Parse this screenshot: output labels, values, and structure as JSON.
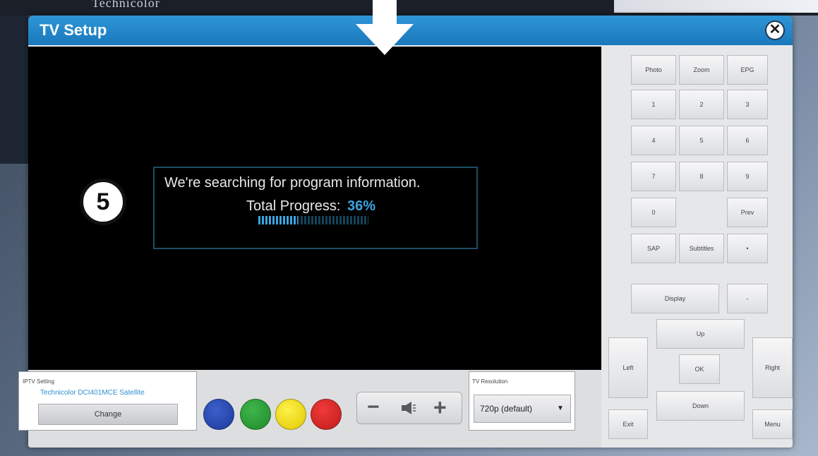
{
  "background": {
    "top_text": "Technicolor"
  },
  "window": {
    "title": "TV Setup",
    "close_symbol": "✕"
  },
  "screen": {
    "message": "We're searching for program information.",
    "progress_label": "Total Progress:",
    "progress_value": "36%",
    "progress_fraction": 0.36,
    "step_number": "5"
  },
  "iptv": {
    "label": "IPTV Setting",
    "value": "Technicolor DCI401MCE Satellite",
    "change_label": "Change"
  },
  "color_buttons": [
    "blue",
    "green",
    "yellow",
    "red"
  ],
  "volume": {
    "minus": "−",
    "plus": "+",
    "speaker_icon": "speaker-icon"
  },
  "resolution": {
    "label": "TV Resolution",
    "value": "720p (default)",
    "caret": "▼"
  },
  "remote": {
    "photo": "Photo",
    "zoom": "Zoom",
    "epg": "EPG",
    "k1": "1",
    "k2": "2",
    "k3": "3",
    "k4": "4",
    "k5": "5",
    "k6": "6",
    "k7": "7",
    "k8": "8",
    "k9": "9",
    "k0": "0",
    "prev": "Prev",
    "sap": "SAP",
    "subtitles": "Subtitles",
    "dot": "•",
    "display": "Display",
    "extra": "-",
    "up": "Up",
    "left": "Left",
    "ok": "OK",
    "right": "Right",
    "down": "Down",
    "exit": "Exit",
    "menu": "Menu"
  },
  "colors": {
    "titlebar": "#1a78bd",
    "accent": "#3aa4e0",
    "progress_track": "#154359"
  }
}
